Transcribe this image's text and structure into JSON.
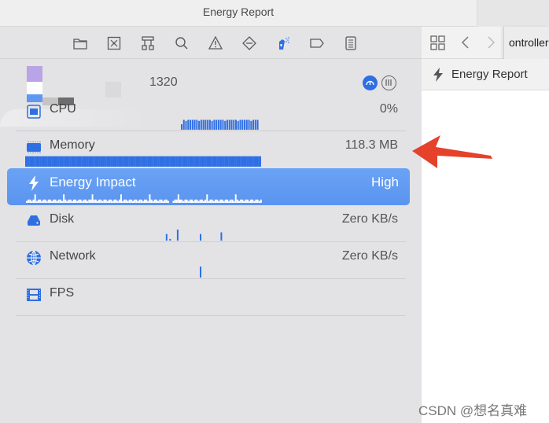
{
  "window": {
    "title": "Energy Report"
  },
  "navigator": {
    "icons": [
      {
        "name": "folder-icon"
      },
      {
        "name": "source-control-icon"
      },
      {
        "name": "hierarchy-icon"
      },
      {
        "name": "search-icon"
      },
      {
        "name": "warning-icon"
      },
      {
        "name": "test-diamond-icon"
      },
      {
        "name": "debug-spray-icon",
        "active": true
      },
      {
        "name": "breakpoint-tag-icon"
      },
      {
        "name": "report-list-icon"
      }
    ]
  },
  "editor_bar": {
    "tab_fragment": "ontroller",
    "grid_icon": "grid-icon",
    "back_icon": "chevron-left-icon",
    "forward_icon": "chevron-right-icon"
  },
  "jumpbar": {
    "icon": "bolt-icon",
    "label": "Energy Report"
  },
  "process": {
    "pid": "1320"
  },
  "gauges": {
    "cpu": {
      "label": "CPU",
      "value": "0%"
    },
    "memory": {
      "label": "Memory",
      "value": "118.3 MB"
    },
    "energy": {
      "label": "Energy Impact",
      "value": "High"
    },
    "disk": {
      "label": "Disk",
      "value": "Zero KB/s"
    },
    "network": {
      "label": "Network",
      "value": "Zero KB/s"
    },
    "fps": {
      "label": "FPS",
      "value": ""
    }
  },
  "colors": {
    "accent": "#2f6fe4",
    "selection": "#5e98f1",
    "arrow": "#e5412b"
  },
  "watermark": "CSDN @想名真难"
}
